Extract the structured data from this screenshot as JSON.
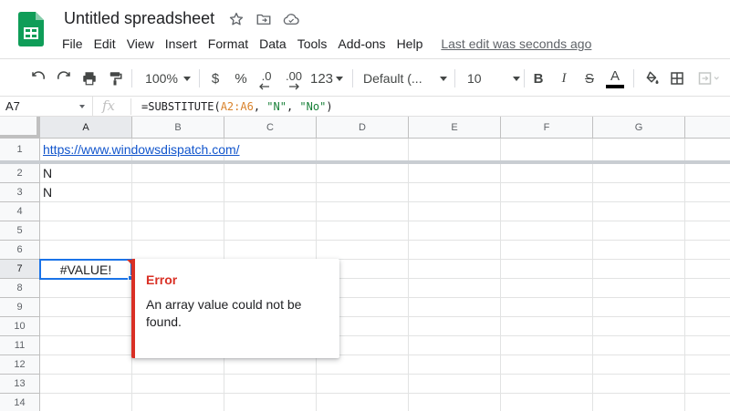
{
  "app": {
    "doc_title": "Untitled spreadsheet",
    "brand_color": "#0f9d58"
  },
  "menu": {
    "items": [
      "File",
      "Edit",
      "View",
      "Insert",
      "Format",
      "Data",
      "Tools",
      "Add-ons",
      "Help"
    ],
    "last_edit": "Last edit was seconds ago"
  },
  "toolbar": {
    "zoom": "100%",
    "currency": "$",
    "percent": "%",
    "decrease_decimal": ".0",
    "increase_decimal": ".00",
    "more_formats": "123",
    "font": "Default (...",
    "font_size": "10",
    "bold": "B",
    "italic": "I",
    "strikethrough": "S",
    "text_color": "A"
  },
  "formula_bar": {
    "name_box": "A7",
    "fx": "fx",
    "prefix": "=SUBSTITUTE(",
    "range": "A2:A6",
    "sep1": ", ",
    "arg1": "\"N\"",
    "sep2": ", ",
    "arg2": "\"No\"",
    "suffix": ")"
  },
  "grid": {
    "columns": [
      "A",
      "B",
      "C",
      "D",
      "E",
      "F",
      "G"
    ],
    "rows": [
      "1",
      "2",
      "3",
      "4",
      "5",
      "6",
      "7",
      "8",
      "9",
      "10",
      "11",
      "12",
      "13",
      "14"
    ],
    "a1": "https://www.windowsdispatch.com/",
    "a2": "N",
    "a3": "N",
    "a7": "#VALUE!",
    "active_cell": "A7"
  },
  "error": {
    "title": "Error",
    "message": "An array value could not be found.",
    "color": "#d93025"
  }
}
